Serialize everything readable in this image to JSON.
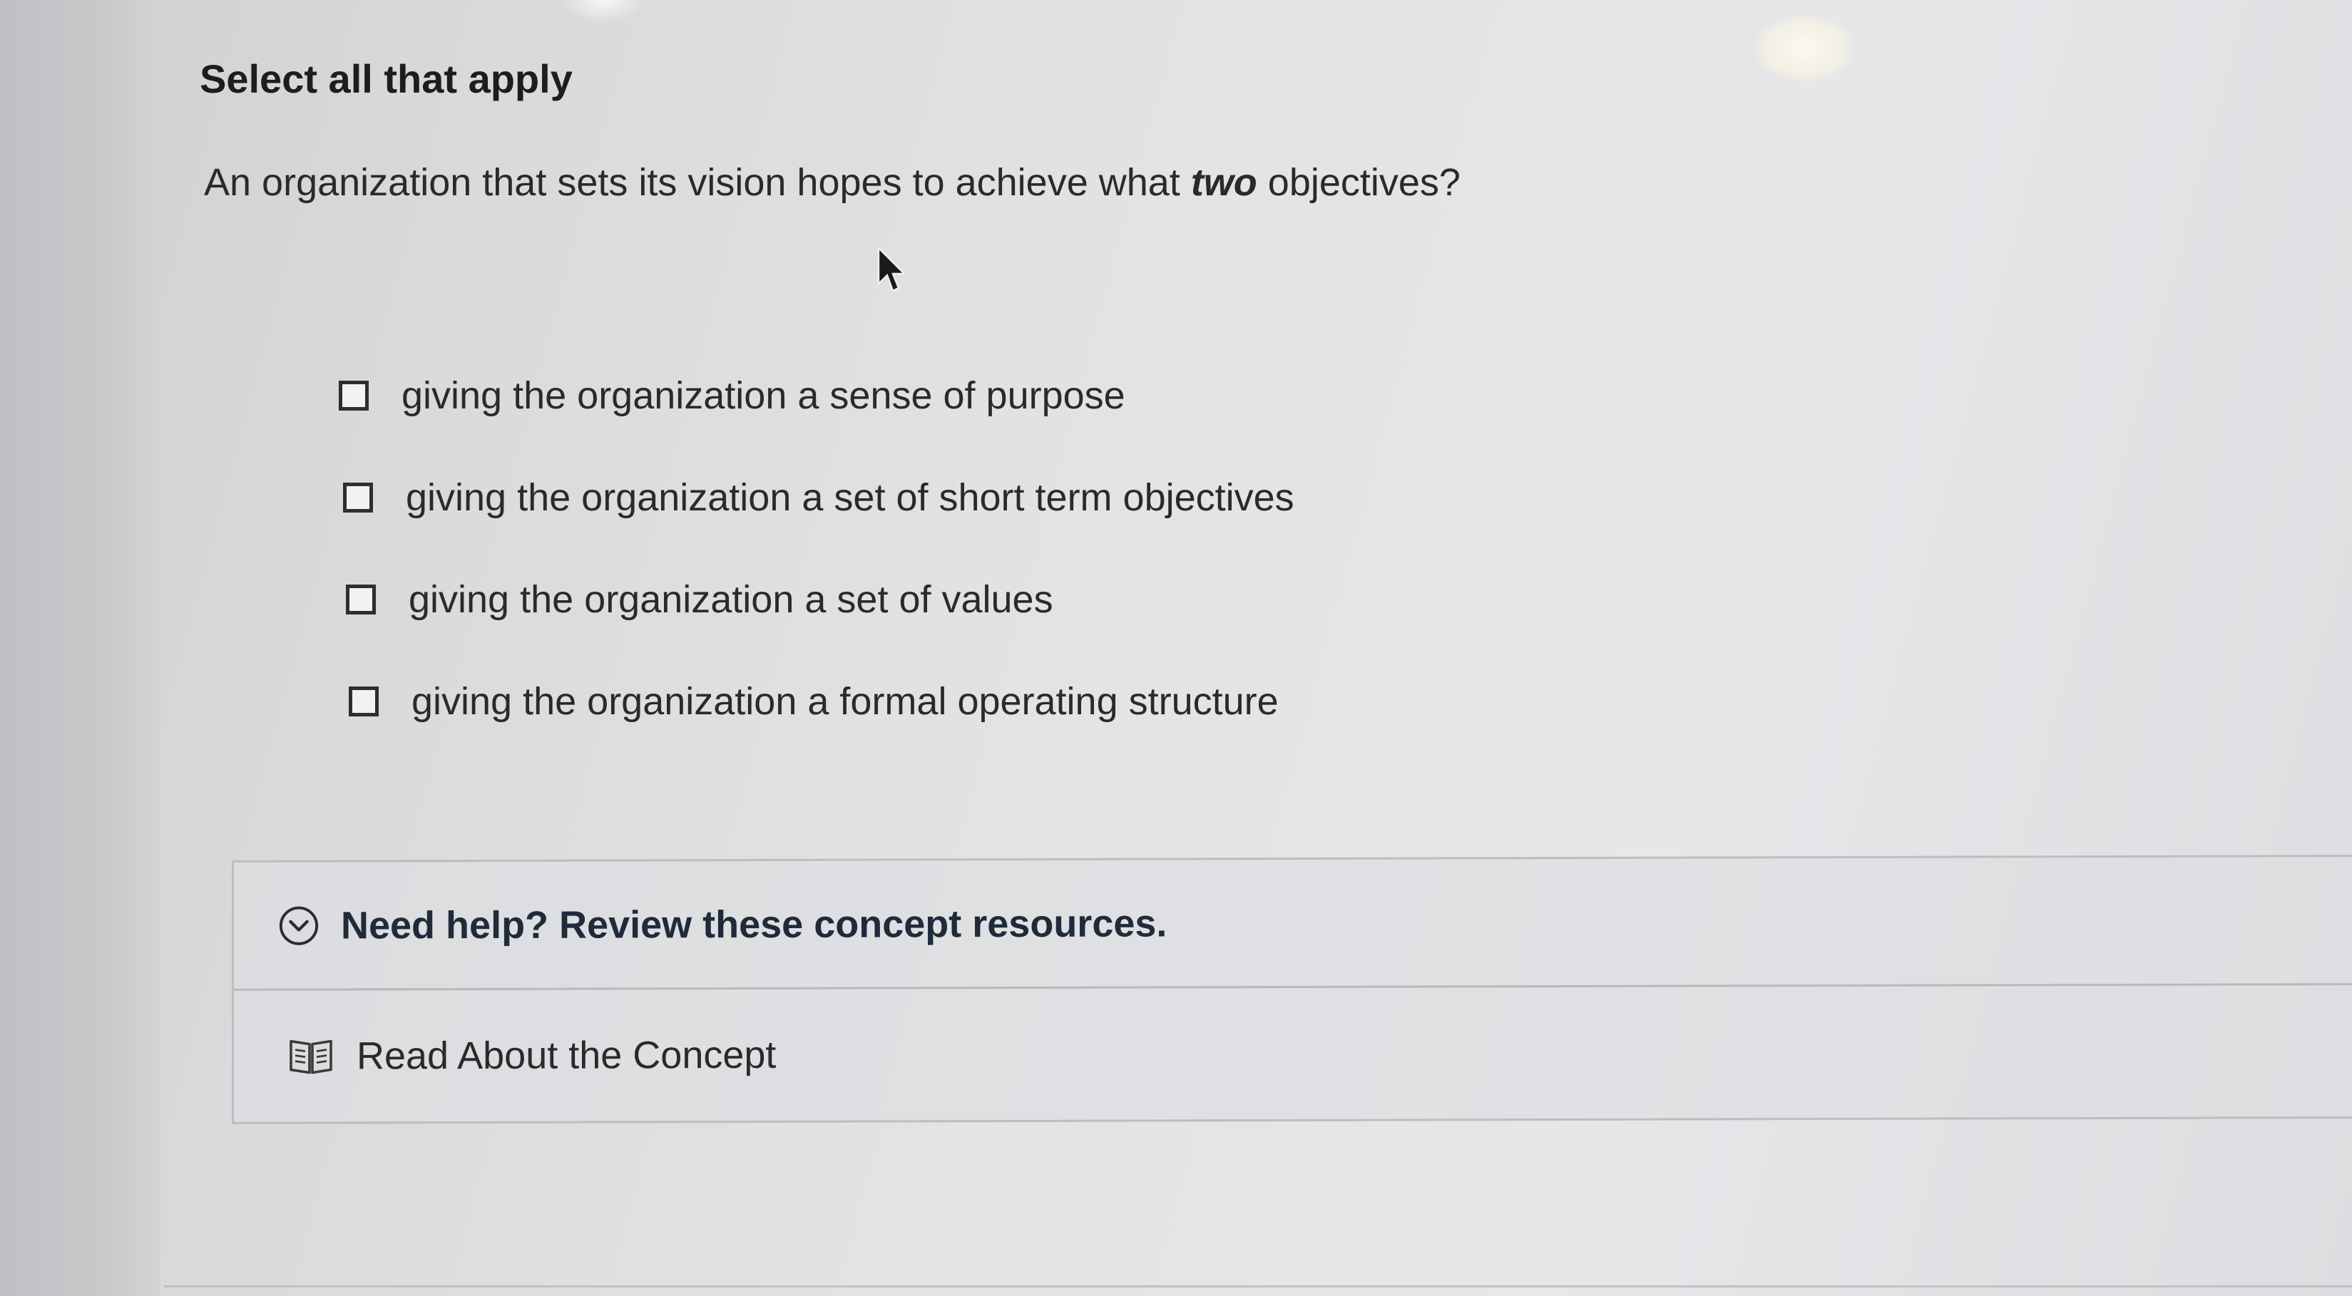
{
  "instruction": "Select all that apply",
  "question": {
    "before": "An organization that sets its vision hopes to achieve what ",
    "emphasis": "two",
    "after": " objectives?"
  },
  "options": [
    {
      "label": "giving the organization a sense of purpose",
      "checked": false
    },
    {
      "label": "giving the organization a set of short term objectives",
      "checked": false
    },
    {
      "label": "giving the organization a set of values",
      "checked": false
    },
    {
      "label": "giving the organization a formal operating structure",
      "checked": false
    }
  ],
  "help": {
    "title": "Need help? Review these concept resources.",
    "icon": "chevron-down-circle-icon",
    "resources": [
      {
        "label": "Read About the Concept",
        "icon": "book-icon"
      }
    ]
  },
  "colors": {
    "text": "#2a2a2a",
    "help_title": "#1f2b3a",
    "border": "#bcbdbf"
  }
}
